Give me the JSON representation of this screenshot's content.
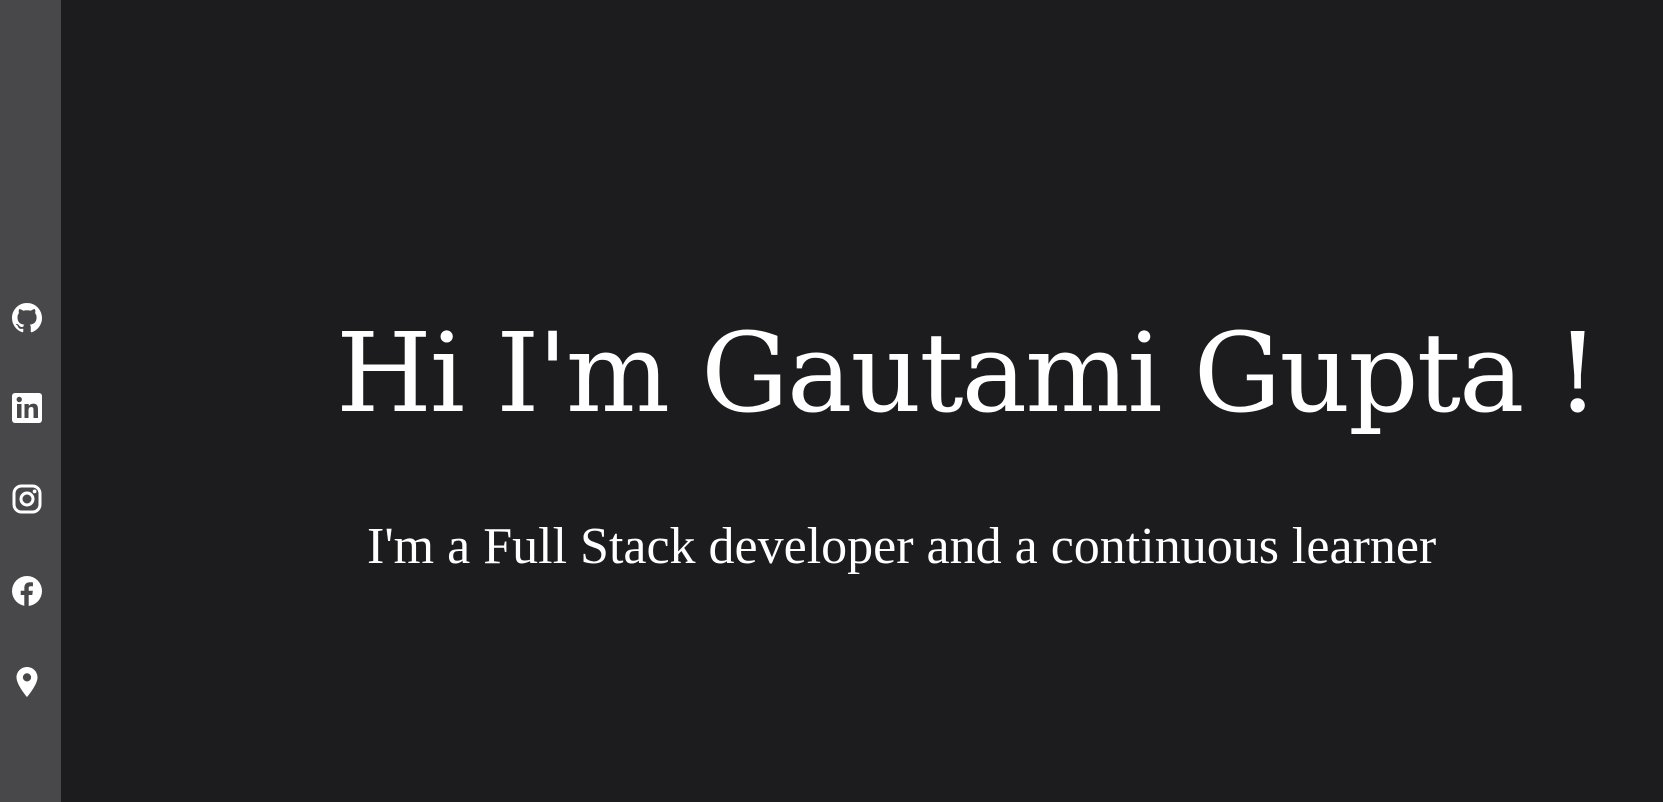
{
  "sidebar": {
    "background": "#48484a",
    "icons": [
      "github-icon",
      "linkedin-icon",
      "instagram-icon",
      "facebook-icon",
      "location-pin-icon"
    ]
  },
  "hero": {
    "title": "Hi I'm Gautami Gupta !",
    "subtitle": "I'm a Full Stack developer and a continuous learner"
  },
  "colors": {
    "page_background": "#1c1c1e",
    "text": "#ffffff",
    "icon": "#ffffff"
  }
}
